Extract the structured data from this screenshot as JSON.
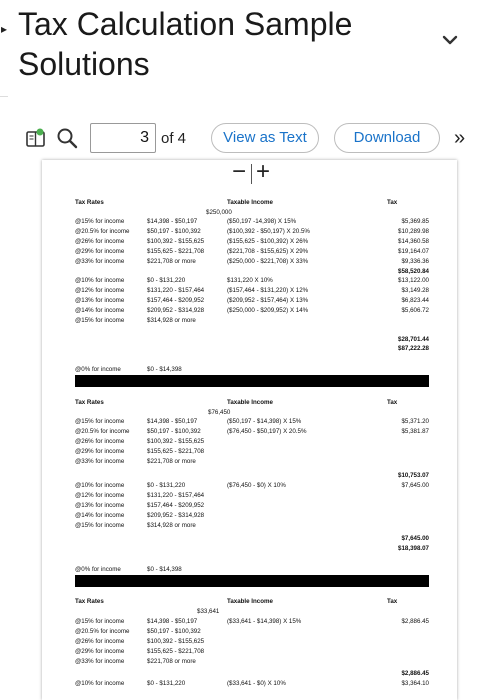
{
  "title": "Tax Calculation Sample Solutions",
  "title_line1": "Tax Calculation Sample",
  "title_line2": "Solutions",
  "toolbar": {
    "page_number": "3",
    "page_of": "of 4",
    "view_as_text": "View as Text",
    "download": "Download",
    "more": "»"
  },
  "zoom": {
    "minus": "−",
    "plus": "+"
  },
  "sections": [
    {
      "hdr_rates": "Tax Rates",
      "hdr_income": "Taxable Income",
      "hdr_tax": "Tax",
      "amount": "$250,000",
      "rates_top": [
        "@15% for income",
        "@20.5% for income",
        "@26% for income",
        "@29% for income",
        "@33% for income"
      ],
      "ranges_top": [
        "$14,398 - $50,197",
        "$50,197 - $100,392",
        "$100,392 - $155,625",
        "$155,625 - $221,708",
        "$221,708 or more"
      ],
      "calc_top": [
        "($50,197 -14,398) X 15%",
        "($100,392 - $50,197) X 20.5%",
        "($155,625 - $100,392) X 26%",
        "($221,708 - $155,625) X 29%",
        "($250,000 - $221,708) X 33%"
      ],
      "tax_top": [
        "$5,369.85",
        "$10,289.98",
        "$14,360.58",
        "$19,164.07",
        "$9,336.36",
        "$58,520.84"
      ],
      "rates_bot": [
        "@10% for income",
        "@12% for income",
        "@13% for income",
        "@14% for income",
        "@15% for income"
      ],
      "ranges_bot": [
        "$0 - $131,220",
        "$131,220 - $157,464",
        "$157,464 - $209,952",
        "$209,952 - $314,928",
        "$314,928 or more"
      ],
      "calc_bot": [
        "$131,220 X 10%",
        "($157,464 - $131,220) X 12%",
        "($209,952 - $157,464) X 13%",
        "($250,000 - $209,952) X 14%"
      ],
      "tax_bot": [
        "$13,122.00",
        "$3,149.28",
        "$6,823.44",
        "$5,606.72"
      ],
      "totals": [
        "$28,701.44",
        "$87,222.28"
      ],
      "zero_rate": "@0% for income",
      "zero_range": "$0 - $14,398"
    },
    {
      "hdr_rates": "Tax Rates",
      "hdr_income": "Taxable Income",
      "hdr_tax": "Tax",
      "amount": "$76,450",
      "rates_top": [
        "@15% for income",
        "@20.5% for income",
        "@26% for income",
        "@29% for income",
        "@33% for income"
      ],
      "ranges_top": [
        "$14,398 - $50,197",
        "$50,197 - $100,392",
        "$100,392 - $155,625",
        "$155,625 - $221,708",
        "$221,708 or more"
      ],
      "calc_top": [
        "($50,197 - $14,398) X 15%",
        "($76,450 - $50,197) X 20.5%"
      ],
      "tax_top": [
        "$5,371.20",
        "$5,381.87"
      ],
      "subtotal": [
        "$10,753.07",
        "$7,645.00"
      ],
      "rates_bot": [
        "@10% for income",
        "@12% for income",
        "@13% for income",
        "@14% for income",
        "@15% for income"
      ],
      "ranges_bot": [
        "$0 - $131,220",
        "$131,220 - $157,464",
        "$157,464 - $209,952",
        "$209,952 - $314,928",
        "$314,928 or more"
      ],
      "calc_bot": [
        "($76,450 - $0) X 10%"
      ],
      "totals": [
        "$7,645.00",
        "$18,398.07"
      ],
      "zero_rate": "@0% for income",
      "zero_range": "$0 - $14,398"
    },
    {
      "hdr_rates": "Tax Rates",
      "hdr_income": "Taxable Income",
      "hdr_tax": "Tax",
      "amount": "$33,641",
      "rates_top": [
        "@15% for income",
        "@20.5% for income",
        "@26% for income",
        "@29% for income",
        "@33% for income"
      ],
      "ranges_top": [
        "$14,398 - $50,197",
        "$50,197 - $100,392",
        "$100,392 - $155,625",
        "$155,625 - $221,708",
        "$221,708 or more"
      ],
      "calc_top": [
        "($33,641 - $14,398) X 15%"
      ],
      "tax_top": [
        "$2,886.45"
      ],
      "subtotal": [
        "$2,886.45",
        "$3,364.10"
      ],
      "rate_last": "@10% for income",
      "range_last": "$0 - $131,220",
      "calc_last": "($33,641 - $0) X 10%"
    }
  ]
}
